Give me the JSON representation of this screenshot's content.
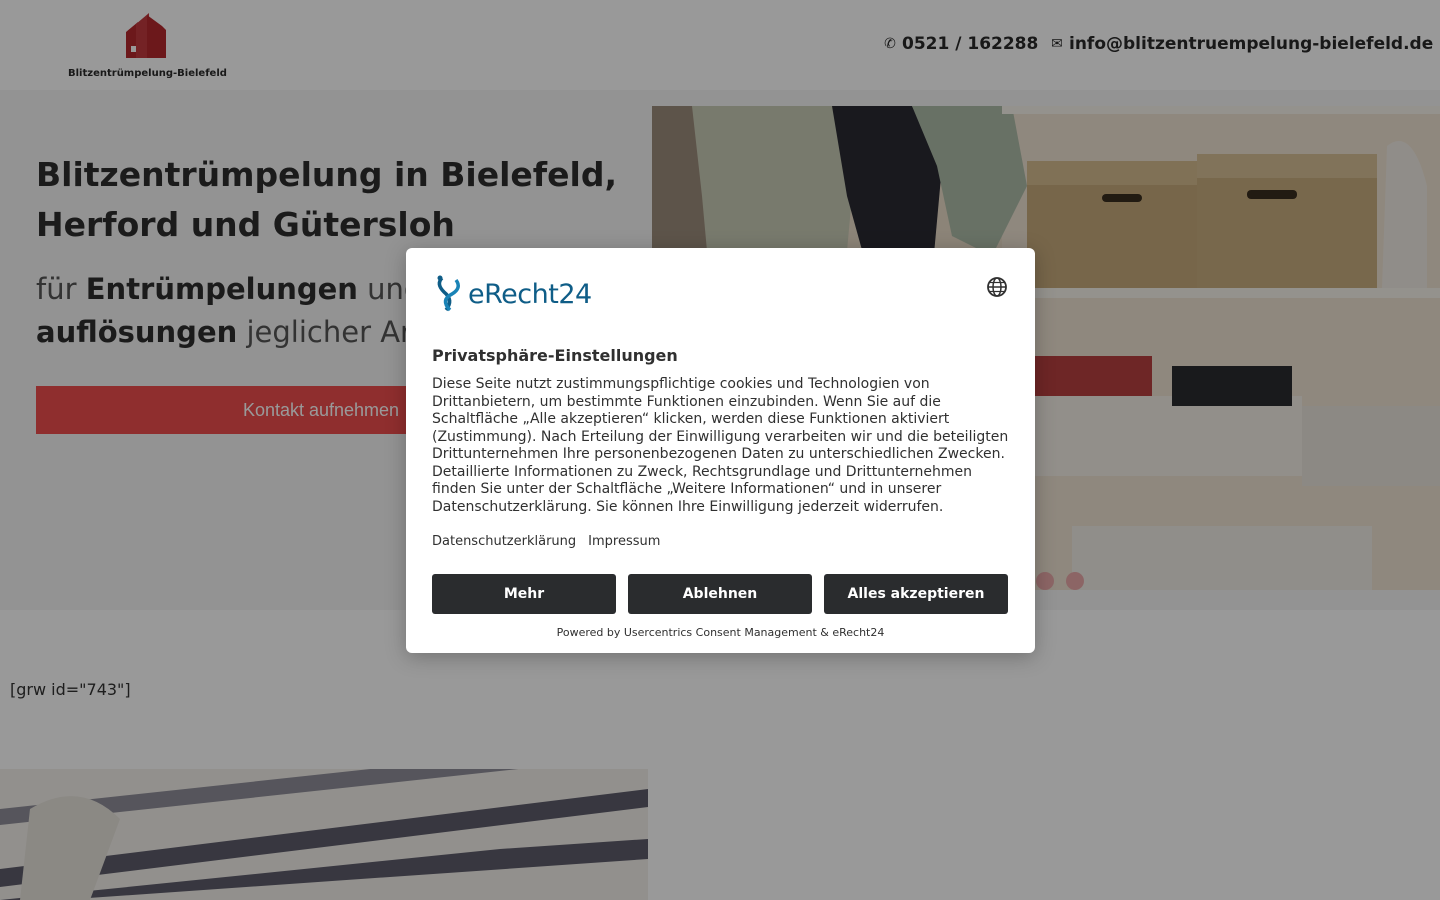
{
  "header": {
    "logo_text": "Blitzentrümpelung-Bielefeld",
    "phone": "0521 / 162288",
    "email": "info@blitzentruempelung-bielefeld.de",
    "brand_color": "#b5282d"
  },
  "hero": {
    "title": "Blitzentrümpelung in Bielefeld, Herford und Gütersloh",
    "subtitle_pre": "für ",
    "subtitle_bold1": "Entrümpelungen",
    "subtitle_mid": " und Haushalts-",
    "subtitle_bold2": "auflösungen",
    "subtitle_post": " jeglicher Art",
    "button_label": "Kontakt aufnehmen",
    "button_color": "#ef4e4e"
  },
  "reviews": {
    "shortcode": "[grw id=\"743\"]"
  },
  "consent": {
    "brand": "eRecht24",
    "title": "Privatsphäre-Einstellungen",
    "body": "Diese Seite nutzt zustimmungspflichtige cookies und Technologien von Drittanbietern, um bestimmte Funktionen einzubinden. Wenn Sie auf die Schaltfläche „Alle akzeptieren“ klicken, werden diese Funktionen aktiviert (Zustimmung). Nach Erteilung der Einwilligung verarbeiten wir und die beteiligten Drittunternehmen Ihre personenbezogenen Daten zu unterschiedlichen Zwecken. Detaillierte Informationen zu Zweck, Rechtsgrundlage und Drittunternehmen finden Sie unter der Schaltfläche „Weitere Informationen“ und in unserer Datenschutzerklärung. Sie können Ihre Einwilligung jederzeit widerrufen.",
    "link_privacy": "Datenschutzerklärung",
    "link_imprint": "Impressum",
    "btn_more": "Mehr",
    "btn_decline": "Ablehnen",
    "btn_accept": "Alles akzeptieren",
    "powered_by": "Powered by Usercentrics Consent Management & eRecht24",
    "brand_color": "#0f5d87"
  },
  "icons": {
    "phone": "phone-icon",
    "mail": "envelope-icon",
    "globe": "globe-icon"
  }
}
